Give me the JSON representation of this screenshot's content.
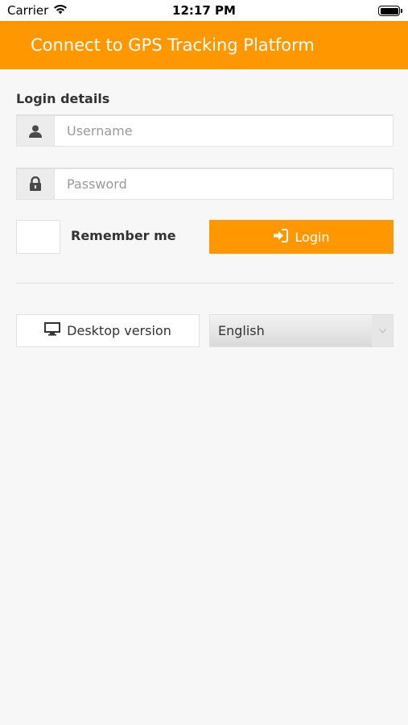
{
  "status_bar": {
    "carrier": "Carrier",
    "time": "12:17 PM"
  },
  "header": {
    "title": "Connect to GPS Tracking Platform"
  },
  "login": {
    "section_title": "Login details",
    "username_placeholder": "Username",
    "password_placeholder": "Password",
    "remember_label": "Remember me",
    "login_label": "Login"
  },
  "footer": {
    "desktop_label": "Desktop version",
    "language_selected": "English"
  },
  "colors": {
    "accent": "#ff9800",
    "background": "#f7f7f7"
  }
}
